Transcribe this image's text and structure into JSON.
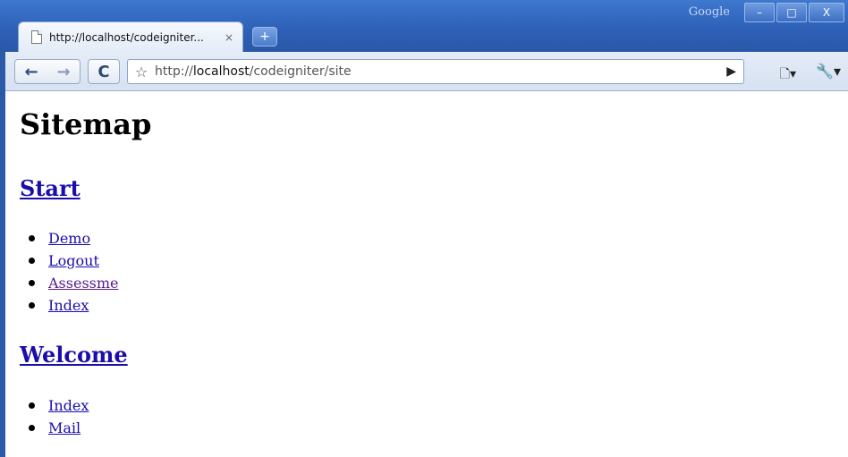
{
  "window": {
    "brand": "Google",
    "buttons": {
      "minimize": "–",
      "maximize": "□",
      "close": "X"
    }
  },
  "tab": {
    "title": "http://localhost/codeigniter...",
    "close": "×",
    "new_tab": "+"
  },
  "toolbar": {
    "back": "←",
    "forward": "→",
    "reload": "C",
    "star": "☆",
    "url_prefix": "http://",
    "url_host": "localhost",
    "url_path": "/codeigniter/site",
    "go": "▶",
    "page_menu": "🗋▾",
    "tools_menu": "🔧▾"
  },
  "page": {
    "heading": "Sitemap",
    "sections": [
      {
        "title": "Start",
        "links": [
          "Demo",
          "Logout",
          "Assessme",
          "Index"
        ]
      },
      {
        "title": "Welcome",
        "links": [
          "Index",
          "Mail"
        ]
      }
    ]
  }
}
